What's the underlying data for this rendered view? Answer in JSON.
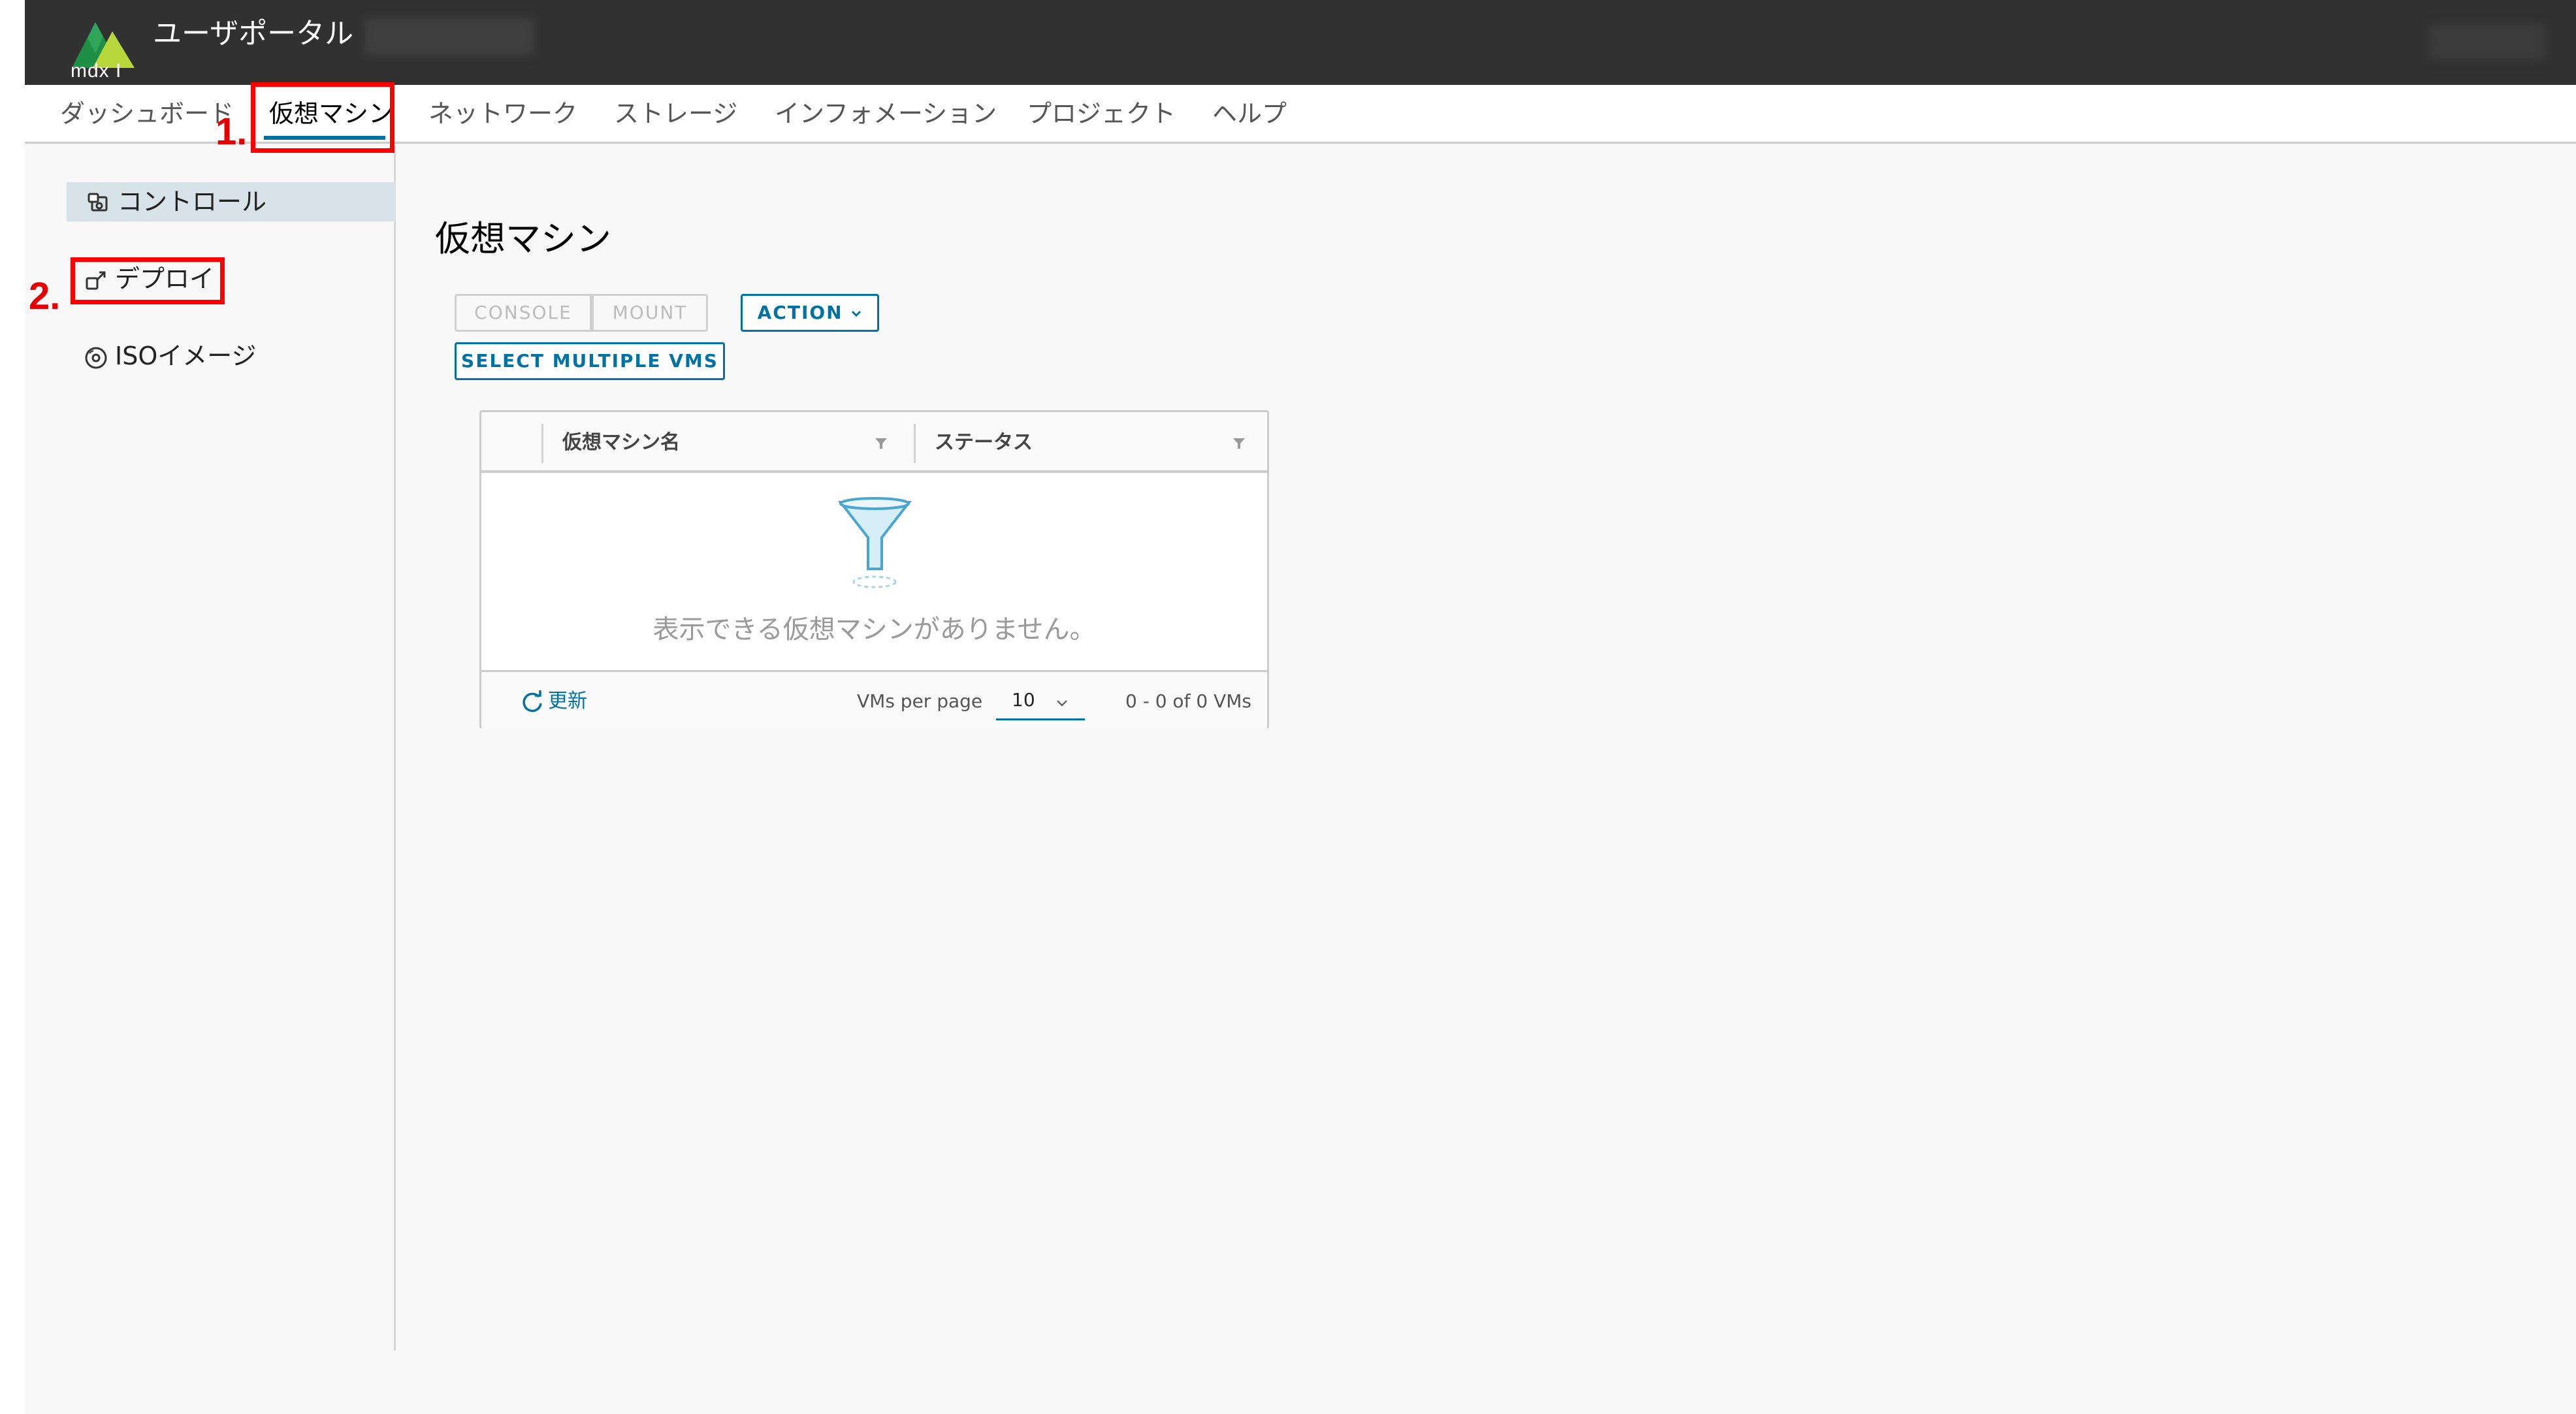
{
  "header": {
    "app_title": "ユーザポータル",
    "logo_text": "mdx I"
  },
  "nav": {
    "tabs": [
      {
        "label": "ダッシュボード"
      },
      {
        "label": "仮想マシン"
      },
      {
        "label": "ネットワーク"
      },
      {
        "label": "ストレージ"
      },
      {
        "label": "インフォメーション"
      },
      {
        "label": "プロジェクト"
      },
      {
        "label": "ヘルプ"
      }
    ],
    "active_tab": "仮想マシン"
  },
  "annotations": {
    "step1": "1.",
    "step2": "2."
  },
  "sidebar": {
    "items": [
      {
        "label": "コントロール",
        "icon": "control-icon"
      },
      {
        "label": "デプロイ",
        "icon": "deploy-icon"
      },
      {
        "label": "ISOイメージ",
        "icon": "disc-icon"
      }
    ],
    "active_item": "コントロール"
  },
  "main": {
    "page_title": "仮想マシン",
    "buttons": {
      "console": "CONSOLE",
      "mount": "MOUNT",
      "action": "ACTION",
      "select_multiple": "SELECT MULTIPLE VMS"
    },
    "grid": {
      "columns": [
        "仮想マシン名",
        "ステータス"
      ],
      "empty_message": "表示できる仮想マシンがありません。",
      "refresh_label": "更新",
      "per_page_label": "VMs per page",
      "per_page_value": "10",
      "pager_text": "0 - 0 of 0 VMs"
    }
  },
  "colors": {
    "header_bg": "#313131",
    "accent": "#0072a3",
    "annotation": "#ff0000",
    "logo_dark": "#1a7f3c",
    "logo_light": "#b9d63a"
  }
}
